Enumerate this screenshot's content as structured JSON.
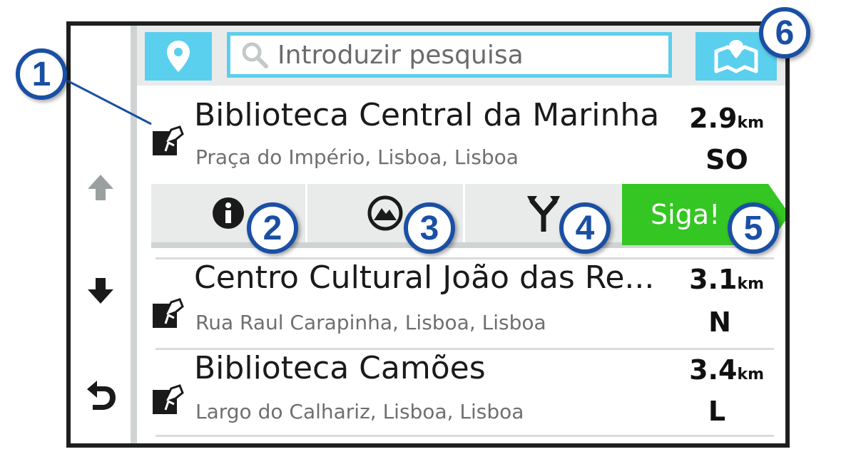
{
  "search": {
    "placeholder": "Introduzir pesquisa"
  },
  "results": [
    {
      "name": "Biblioteca Central da Marinha",
      "address": "Praça do Império, Lisboa, Lisboa",
      "distance": "2.9",
      "unit": "km",
      "direction": "SO"
    },
    {
      "name": "Centro Cultural João das Re...",
      "address": "Rua Raul Carapinha, Lisboa, Lisboa",
      "distance": "3.1",
      "unit": "km",
      "direction": "N"
    },
    {
      "name": "Biblioteca Camões",
      "address": "Largo do Calhariz, Lisboa, Lisboa",
      "distance": "3.4",
      "unit": "km",
      "direction": "L"
    }
  ],
  "action_bar": {
    "go_label": "Siga!"
  },
  "callouts": [
    "1",
    "2",
    "3",
    "4",
    "5",
    "6"
  ],
  "icons": {
    "location": "map-pin-icon",
    "search": "magnifier-icon",
    "map": "map-view-icon",
    "up": "arrow-up-icon",
    "down": "arrow-down-icon",
    "back": "back-arrow-icon",
    "info": "info-icon",
    "elevation": "mountain-icon",
    "route": "fork-route-icon",
    "poi": "poi-category-icon"
  },
  "colors": {
    "accent": "#5bcfee",
    "go": "#34c622",
    "callout": "#1a4fa3",
    "frame": "#1f1f1f"
  }
}
